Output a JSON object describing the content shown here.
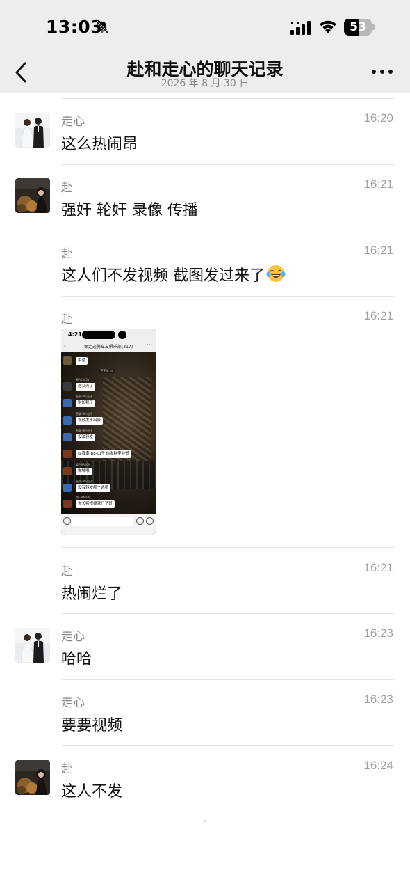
{
  "status_bar": {
    "time": "13:03",
    "battery_text": "53",
    "battery_level_percent": 53,
    "icons": [
      "bell-off-icon",
      "cellular-signal-icon",
      "wifi-icon",
      "battery-icon"
    ]
  },
  "header": {
    "title": "赴和走心的聊天记录",
    "date": "2026 年 8 月 30 日",
    "back_icon": "chevron-left-icon",
    "more_icon": "more-dots-icon"
  },
  "messages": [
    {
      "sender": "走心",
      "time": "16:20",
      "text": "这么热闹昂",
      "avatar": "avatar-zouxin"
    },
    {
      "sender": "赴",
      "time": "16:21",
      "text": "强奸 轮奸 录像 传播",
      "avatar": "avatar-fu"
    },
    {
      "sender": "赴",
      "time": "16:21",
      "text": "这人们不发视频 截图发过来了",
      "emoji": "laughing-tears-emoji"
    },
    {
      "sender": "赴",
      "time": "16:21",
      "type": "image"
    },
    {
      "sender": "赴",
      "time": "16:21",
      "text": "热闹烂了"
    },
    {
      "sender": "走心",
      "time": "16:23",
      "text": "哈哈",
      "avatar": "avatar-zouxin"
    },
    {
      "sender": "走心",
      "time": "16:23",
      "text": "要要视频"
    },
    {
      "sender": "赴",
      "time": "16:24",
      "text": "这人不发",
      "avatar": "avatar-fu"
    }
  ],
  "screenshot_image": {
    "status_time": "4:21",
    "group_title": "保定迈腾车友俱乐部(317)",
    "center_time": "下午4:14",
    "chat": [
      {
        "name": "",
        "text": "牛逼"
      },
      {
        "name": "黄A23x5a",
        "text": "这又火了"
      },
      {
        "name": "直隶-B8-山子",
        "text": "别加我了"
      },
      {
        "name": "直隶-B8-山子",
        "text": "视频发不出去"
      },
      {
        "name": "直隶-B8-山子",
        "text": "没法转发"
      },
      {
        "name": "",
        "text": "@直隶-B8-山子 你发群里啦哥"
      },
      {
        "name": "冀F·9A00N",
        "text": "啪啪啪"
      },
      {
        "name": "直隶-B8-山子",
        "text": "没有转发那个选项"
      },
      {
        "name": "冀F·9A00N",
        "text": "你长按视频就行了哥"
      }
    ]
  }
}
